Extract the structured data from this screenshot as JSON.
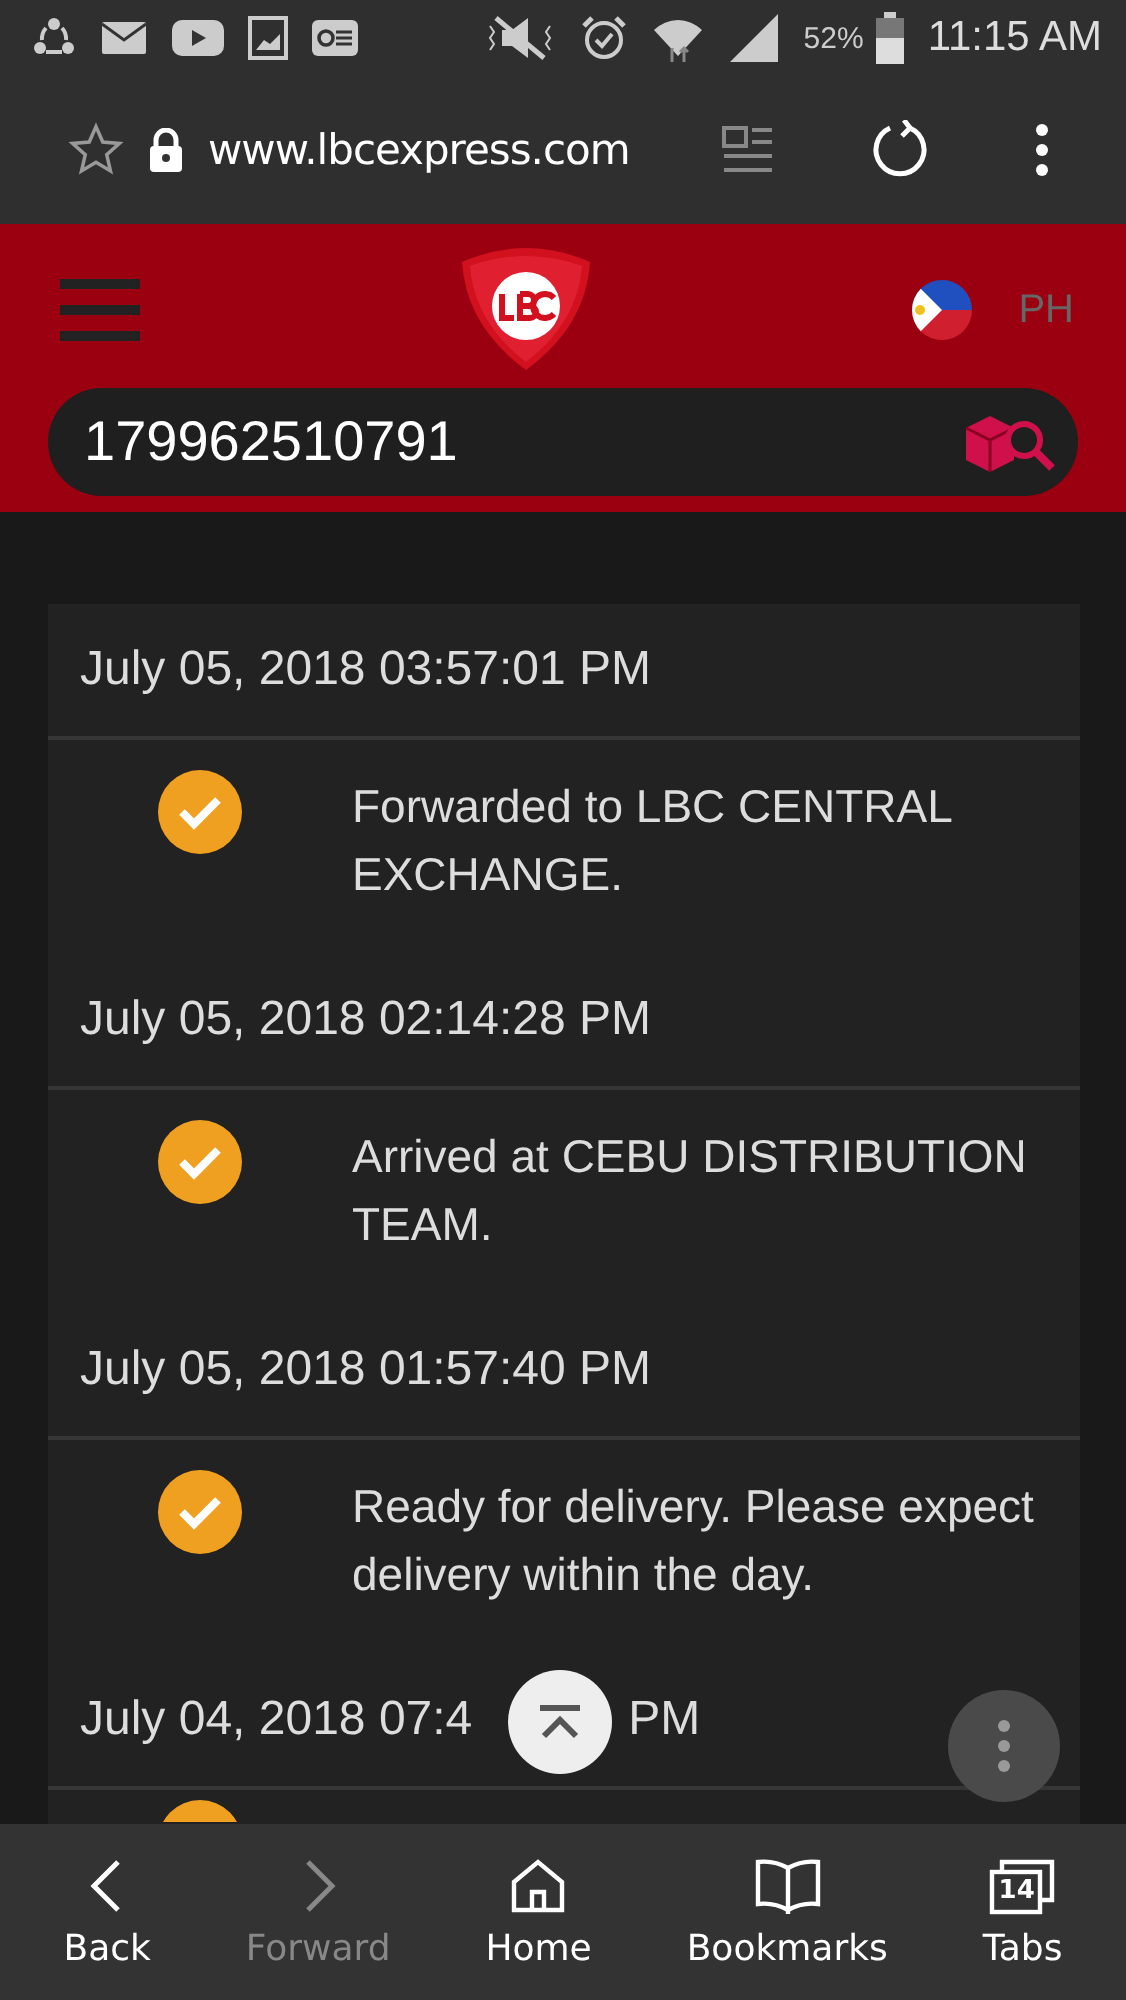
{
  "status_bar": {
    "battery_text": "52%",
    "time": "11:15 AM"
  },
  "address_bar": {
    "url": "www.lbcexpress.com"
  },
  "header": {
    "region": "PH",
    "search": {
      "value": "179962510791"
    }
  },
  "tracking": [
    {
      "kind": "full",
      "date": "July 05, 2018 03:57:01 PM",
      "event": "Forwarded to LBC CENTRAL EXCHANGE.",
      "done": true
    },
    {
      "kind": "full",
      "date": "July 05, 2018 02:14:28 PM",
      "event": "Arrived at CEBU DISTRIBUTION TEAM.",
      "done": true
    },
    {
      "kind": "full",
      "date": "July 05, 2018 01:57:40 PM",
      "event": "Ready for delivery. Please expect delivery within the day.",
      "done": true
    },
    {
      "kind": "partial",
      "date_start": "July 04, 2018 07:4",
      "date_end": "PM",
      "done": true
    }
  ],
  "bottom_nav": [
    {
      "label": "Back",
      "disabled": false
    },
    {
      "label": "Forward",
      "disabled": true
    },
    {
      "label": "Home",
      "disabled": false
    },
    {
      "label": "Bookmarks",
      "disabled": false
    },
    {
      "label": "Tabs",
      "count": "14",
      "disabled": false
    }
  ]
}
